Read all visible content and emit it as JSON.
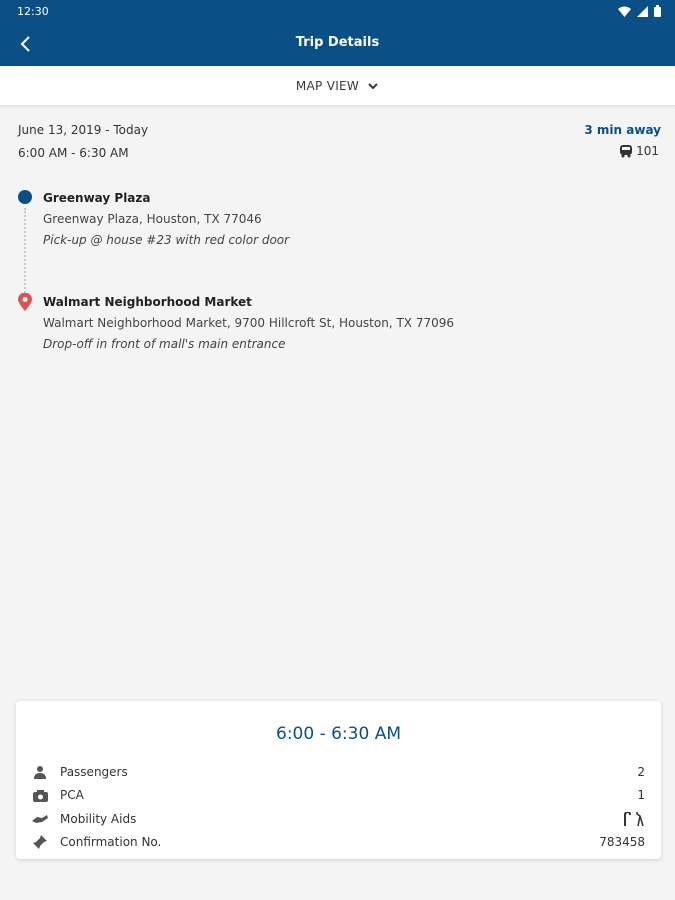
{
  "status_bar": {
    "time": "12:30"
  },
  "header": {
    "title": "Trip Details"
  },
  "map_toggle": {
    "label": "MAP VIEW"
  },
  "trip": {
    "date": "June 13, 2019 - Today",
    "time_range": "6:00 AM - 6:30 AM",
    "eta": "3 min away",
    "vehicle_number": "101"
  },
  "stops": [
    {
      "name": "Greenway Plaza",
      "address": "Greenway Plaza, Houston, TX 77046",
      "note": "Pick-up @ house #23 with red color door"
    },
    {
      "name": "Walmart Neighborhood Market",
      "address": "Walmart Neighborhood Market, 9700 Hillcroft St, Houston, TX 77096",
      "note": "Drop-off in front of mall's main entrance"
    }
  ],
  "summary": {
    "time": "6:00 - 6:30 AM",
    "rows": [
      {
        "label": "Passengers",
        "value": "2",
        "icon": "person-icon"
      },
      {
        "label": "PCA",
        "value": "1",
        "icon": "camera-icon"
      },
      {
        "label": "Mobility Aids",
        "value": "",
        "icon": "hand-icon"
      },
      {
        "label": "Confirmation No.",
        "value": "783458",
        "icon": "pin-icon"
      }
    ]
  },
  "colors": {
    "primary": "#0b4f87",
    "destination_pin": "#e05252",
    "background": "#f4f4f4"
  }
}
